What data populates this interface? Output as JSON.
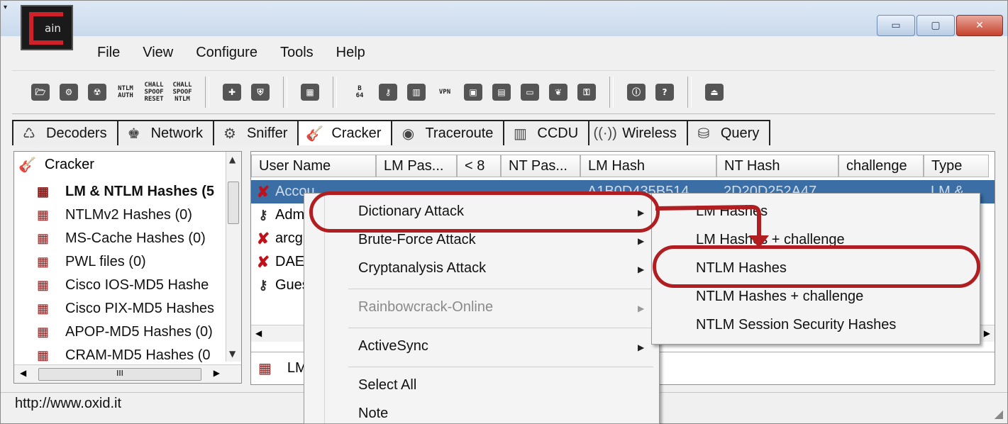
{
  "window": {
    "logo_text": "ain",
    "minimize_label": "▭",
    "maximize_label": "▢",
    "close_label": "✕"
  },
  "menubar": [
    "File",
    "View",
    "Configure",
    "Tools",
    "Help"
  ],
  "toolbar": {
    "groups": [
      [
        {
          "name": "open-icon",
          "glyph": "🗁"
        },
        {
          "name": "sniffer-toggle-icon",
          "glyph": "⚙"
        },
        {
          "name": "apr-icon",
          "glyph": "☢"
        },
        {
          "name": "ntlm-auth-icon",
          "text": "NTLM\nAUTH"
        },
        {
          "name": "chall-spoof-reset-icon",
          "text": "CHALL\nSPOOF\nRESET"
        },
        {
          "name": "chall-spoof-ntlm-icon",
          "text": "CHALL\nSPOOF\nNTLM"
        }
      ],
      [
        {
          "name": "add-icon",
          "glyph": "✚"
        },
        {
          "name": "shield-icon",
          "glyph": "⛨"
        }
      ],
      [
        {
          "name": "decoder-icon",
          "glyph": "▦"
        }
      ],
      [
        {
          "name": "base64-icon",
          "text": "B\n64"
        },
        {
          "name": "key-icon",
          "glyph": "⚷"
        },
        {
          "name": "chart-icon",
          "glyph": "▥"
        },
        {
          "name": "vpn-icon",
          "text": "VPN"
        },
        {
          "name": "pc-icon",
          "glyph": "▣"
        },
        {
          "name": "calculator-icon",
          "glyph": "▤"
        },
        {
          "name": "terminal-icon",
          "glyph": "▭"
        },
        {
          "name": "wireless-tool-icon",
          "glyph": "❦"
        },
        {
          "name": "password-icon",
          "glyph": "⚿"
        }
      ],
      [
        {
          "name": "info-icon",
          "glyph": "ⓘ"
        },
        {
          "name": "help-icon",
          "glyph": "?"
        }
      ],
      [
        {
          "name": "exit-icon",
          "glyph": "⏏"
        }
      ]
    ]
  },
  "tabs": [
    {
      "label": "Decoders",
      "icon": "decoders-icon",
      "glyph": "♺"
    },
    {
      "label": "Network",
      "icon": "network-icon",
      "glyph": "♚"
    },
    {
      "label": "Sniffer",
      "icon": "sniffer-icon",
      "glyph": "⚙"
    },
    {
      "label": "Cracker",
      "icon": "cracker-icon",
      "glyph": "🎸",
      "active": true
    },
    {
      "label": "Traceroute",
      "icon": "traceroute-icon",
      "glyph": "◉"
    },
    {
      "label": "CCDU",
      "icon": "ccdu-icon",
      "glyph": "▥"
    },
    {
      "label": "Wireless",
      "icon": "wireless-icon",
      "glyph": "((·))"
    },
    {
      "label": "Query",
      "icon": "query-icon",
      "glyph": "⛁"
    }
  ],
  "tree": {
    "root": "Cracker",
    "items": [
      {
        "label": "LM & NTLM Hashes (5",
        "selected": true
      },
      {
        "label": "NTLMv2 Hashes (0)"
      },
      {
        "label": "MS-Cache Hashes (0)"
      },
      {
        "label": "PWL files (0)"
      },
      {
        "label": "Cisco IOS-MD5 Hashe"
      },
      {
        "label": "Cisco PIX-MD5 Hashes"
      },
      {
        "label": "APOP-MD5 Hashes (0)"
      },
      {
        "label": "CRAM-MD5 Hashes (0"
      }
    ],
    "hscroll_thumb": "III"
  },
  "grid": {
    "columns": [
      "User Name",
      "LM Pas...",
      "< 8",
      "NT Pas...",
      "LM Hash",
      "NT Hash",
      "challenge",
      "Type"
    ],
    "rows": [
      {
        "icon": "x",
        "user": "Accou",
        "lm_hash": "A1B0D435B514",
        "nt_hash": "2D20D252A47",
        "type": "LM &",
        "selected": true
      },
      {
        "icon": "key",
        "user": "Admi"
      },
      {
        "icon": "x",
        "user": "arcgi"
      },
      {
        "icon": "x",
        "user": "DAEM"
      },
      {
        "icon": "key",
        "user": "Gues"
      }
    ],
    "footer_label": "LM"
  },
  "context_menu": {
    "items": [
      {
        "label": "Dictionary Attack",
        "submenu": true
      },
      {
        "label": "Brute-Force Attack",
        "submenu": true
      },
      {
        "label": "Cryptanalysis Attack",
        "submenu": true
      },
      {
        "label": "Rainbowcrack-Online",
        "submenu": true,
        "disabled": true
      },
      {
        "label": "ActiveSync",
        "submenu": true
      },
      {
        "label": "Select All"
      },
      {
        "label": "Note"
      }
    ]
  },
  "submenu": {
    "items": [
      "LM Hashes",
      "LM Hashes + challenge",
      "NTLM Hashes",
      "NTLM Hashes + challenge",
      "NTLM Session Security Hashes"
    ]
  },
  "status": {
    "url": "http://www.oxid.it"
  },
  "colors": {
    "highlight": "#b01e22",
    "selection": "#3b6ea5",
    "logo_red": "#d0202a"
  }
}
